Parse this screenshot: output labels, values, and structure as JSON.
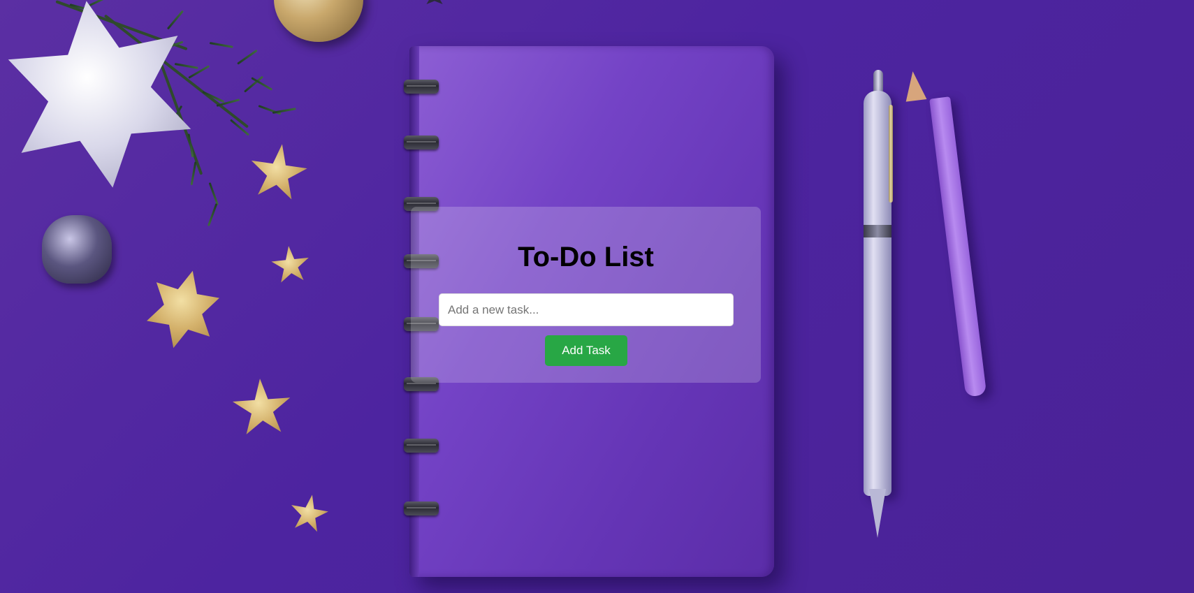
{
  "background": {
    "color": "#4e25a0",
    "description_icons": [
      "notebook-image",
      "pen-image",
      "pencil-image",
      "star-ornament-icon",
      "pine-branch-image",
      "ornament-ball-icon",
      "bell-ornament-icon"
    ]
  },
  "todo": {
    "title": "To-Do List",
    "input_placeholder": "Add a new task...",
    "input_value": "",
    "add_button_label": "Add Task"
  },
  "colors": {
    "accent_button": "#28a745",
    "panel_overlay": "rgba(255,255,255,0.2)",
    "title_text": "#000000"
  }
}
